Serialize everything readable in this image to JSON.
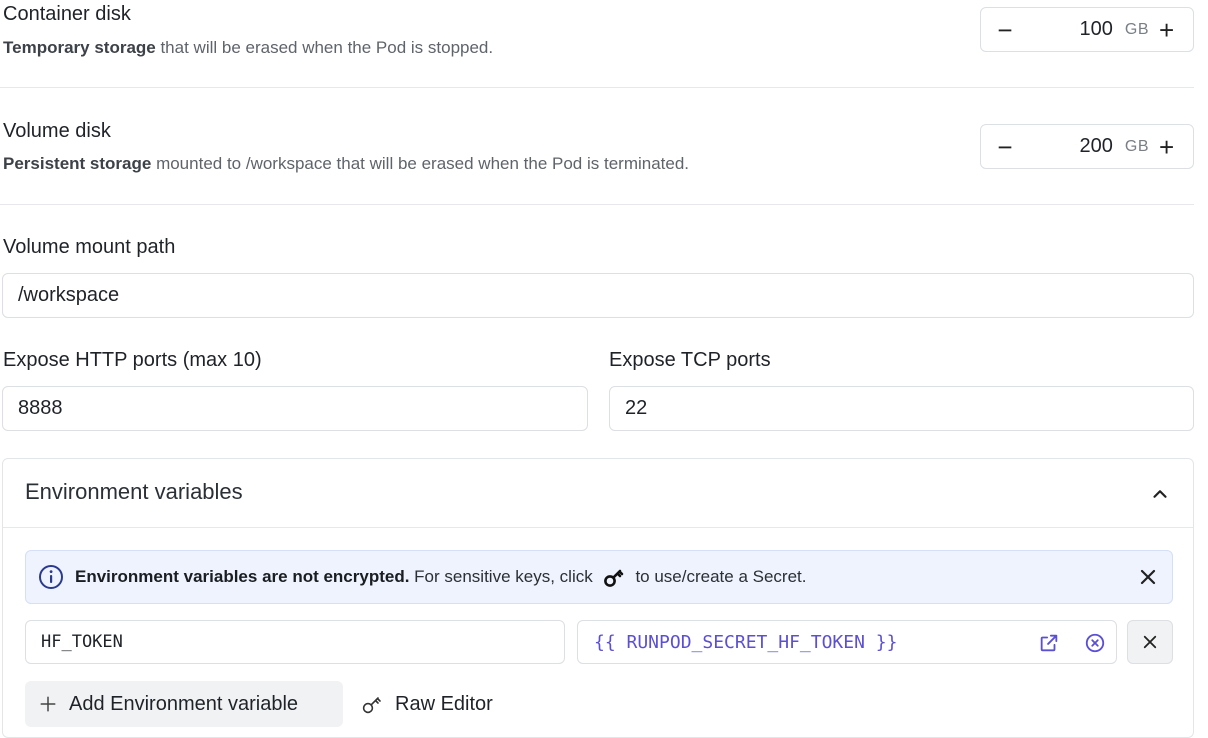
{
  "container_disk": {
    "title": "Container disk",
    "desc_bold": "Temporary storage",
    "desc_rest": " that will be erased when the Pod is stopped.",
    "minus": "−",
    "value": "100",
    "unit": "GB",
    "plus": "+"
  },
  "volume_disk": {
    "title": "Volume disk",
    "desc_bold": "Persistent storage",
    "desc_rest": " mounted to /workspace that will be erased when the Pod is terminated.",
    "minus": "−",
    "value": "200",
    "unit": "GB",
    "plus": "+"
  },
  "mount_path": {
    "label": "Volume mount path",
    "value": "/workspace"
  },
  "http_ports": {
    "label": "Expose HTTP ports (max 10)",
    "value": "8888"
  },
  "tcp_ports": {
    "label": "Expose TCP ports",
    "value": "22"
  },
  "env": {
    "title": "Environment variables",
    "banner_bold": "Environment variables are not encrypted.",
    "banner_pre": " For sensitive keys, click ",
    "banner_post": " to use/create a Secret.",
    "key": "HF_TOKEN",
    "value": "{{ RUNPOD_SECRET_HF_TOKEN }}",
    "add_label": "Add Environment variable",
    "raw_label": "Raw Editor"
  },
  "colors": {
    "accent_purple": "#5b4fd6",
    "banner_bg": "#eef3fd",
    "border": "#dcdfe3"
  },
  "icons": {
    "chevron": "chevron-up-icon",
    "info": "info-icon",
    "key": "key-icon",
    "close": "close-icon",
    "external": "external-link-icon",
    "clear": "clear-circle-icon",
    "plus": "plus-icon"
  }
}
